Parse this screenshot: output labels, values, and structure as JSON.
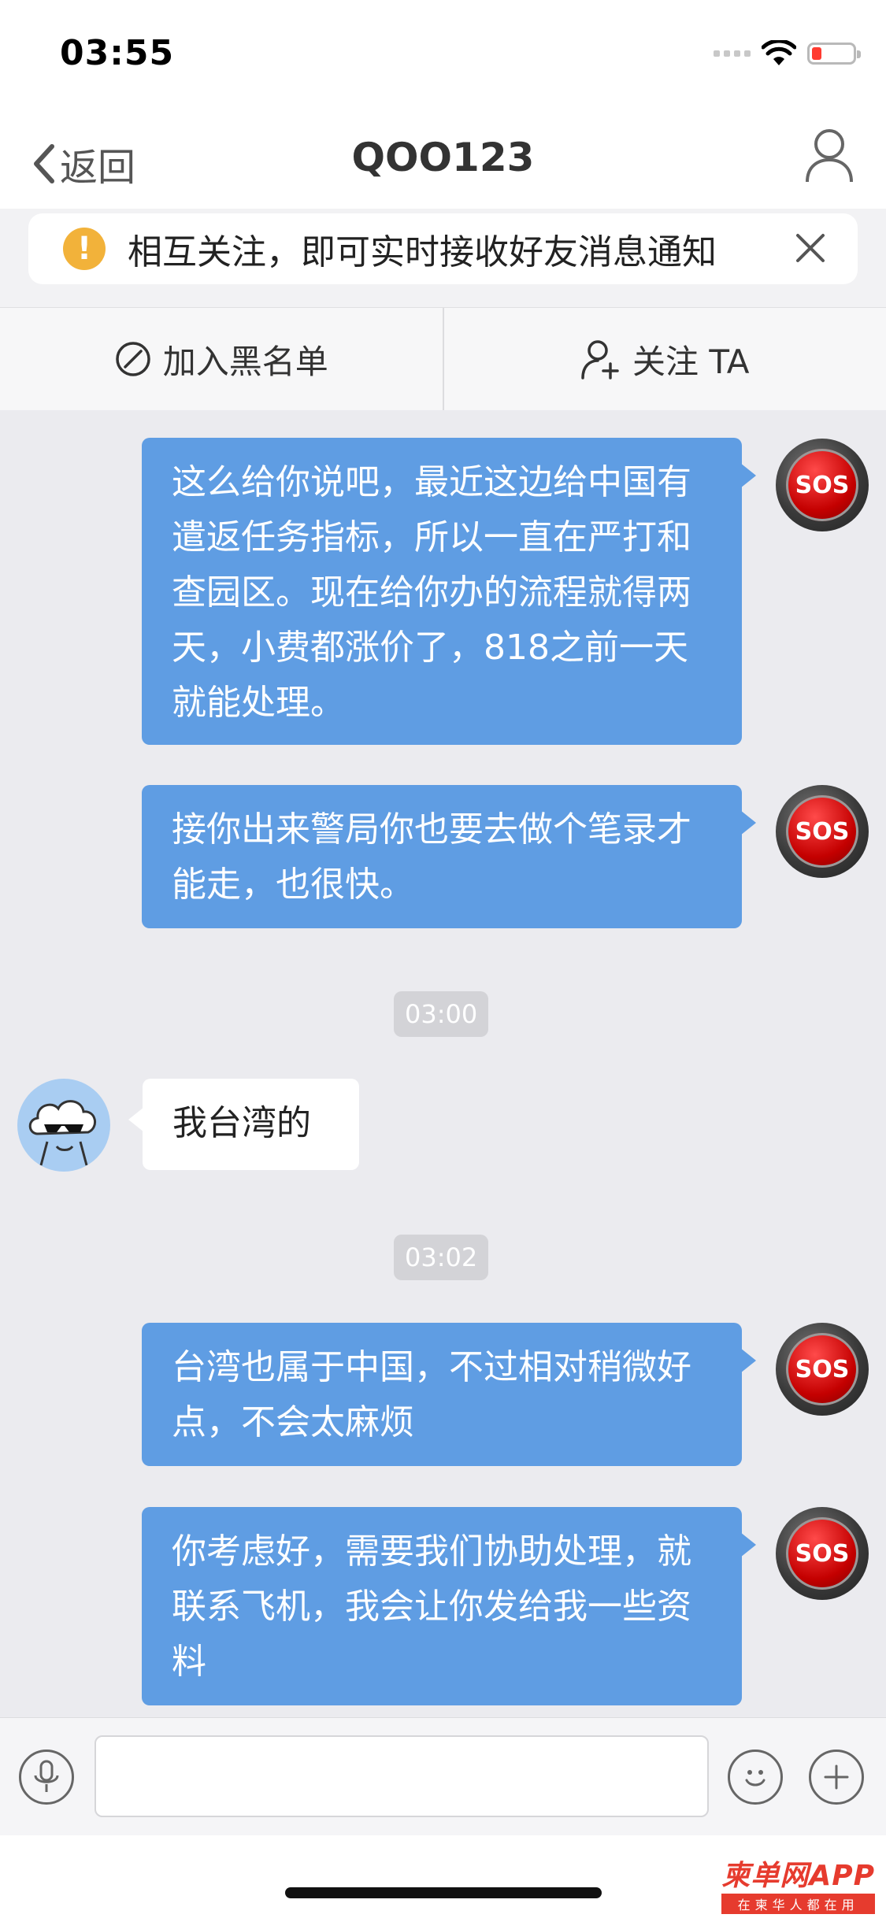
{
  "status_bar": {
    "time": "03:55"
  },
  "nav": {
    "back_label": "返回",
    "title": "QOO123"
  },
  "notice": {
    "text": "相互关注，即可实时接收好友消息通知"
  },
  "actions": {
    "blacklist_label": "加入黑名单",
    "follow_label": "关注 TA"
  },
  "messages": [
    {
      "side": "out",
      "avatar_label": "SOS",
      "text": "这么给你说吧，最近这边给中国有遣返任务指标，所以一直在严打和查园区。现在给你办的流程就得两天，小费都涨价了，818之前一天就能处理。"
    },
    {
      "side": "out",
      "avatar_label": "SOS",
      "text": "接你出来警局你也要去做个笔录才能走，也很快。"
    },
    {
      "side": "time",
      "text": "03:00"
    },
    {
      "side": "in",
      "text": "我台湾的"
    },
    {
      "side": "time",
      "text": "03:02"
    },
    {
      "side": "out",
      "avatar_label": "SOS",
      "text": "台湾也属于中国，不过相对稍微好点，不会太麻烦"
    },
    {
      "side": "out",
      "avatar_label": "SOS",
      "text": "你考虑好，需要我们协助处理，就联系飞机，我会让你发给我一些资料"
    }
  ],
  "watermark": {
    "main": "柬单网APP",
    "sub": "在柬华人都在用"
  },
  "colors": {
    "outgoing_bubble": "#5f9de3",
    "chat_background": "#ebebef",
    "warning": "#f2b23a"
  }
}
